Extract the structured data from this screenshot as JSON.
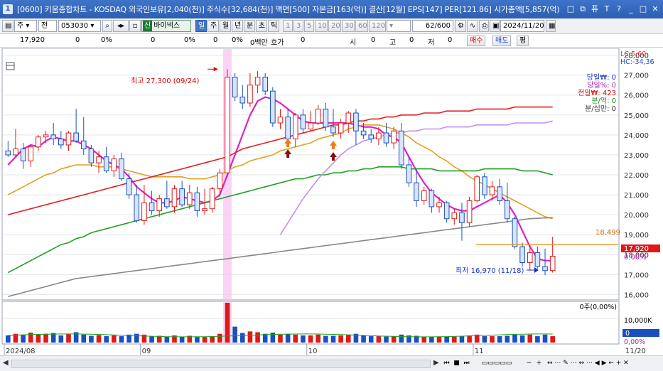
{
  "window": {
    "title": "[0600] 키움종합차트 - KOSDAQ 외국인보유[2,040(천)] 주식수[32,684(천)] 액면[500] 자본금[163(억)] 결산[12월] EPS[147] PER[121.86] 시가총액[5,857(억)",
    "title_icon": "1",
    "controls": [
      "□",
      "⧉",
      "퓨",
      "T",
      "?",
      "_",
      "□",
      "✕"
    ]
  },
  "toolbar": {
    "period_type": "주",
    "compare": "전",
    "code": "053030",
    "sin": "신",
    "name": "바이넥스",
    "period_buttons": [
      "일",
      "주",
      "월",
      "년",
      "분",
      "초",
      "틱"
    ],
    "active_period": "일",
    "interval_buttons": [
      "1",
      "3",
      "5",
      "10",
      "20",
      "30",
      "60",
      "120"
    ],
    "count": "62",
    "count_total": "/600",
    "date": "2024/11/20"
  },
  "quote": {
    "price": "17,920",
    "v1": "0",
    "v1p": "0%",
    "v2": "0",
    "v2p": "0%",
    "v3": "0",
    "v3p": "0%",
    "unit": "0백만",
    "hoga_label": "호가",
    "hoga_val": "0",
    "si_label": "시",
    "si_val": "0",
    "go_label": "고",
    "go_val": "0",
    "jeo_label": "저",
    "jeo_val": "0",
    "buy": "매수",
    "sell": "매도",
    "pyeong": "평"
  },
  "chart_data": {
    "type": "candlestick",
    "y_axis": {
      "min": 15800,
      "max": 28200,
      "ticks": [
        "28,000",
        "27,000",
        "26,000",
        "25,000",
        "24,000",
        "23,000",
        "22,000",
        "21,000",
        "20,000",
        "19,000",
        "18,000",
        "17,000",
        "16,000"
      ]
    },
    "x_axis_labels": [
      "2024/08",
      "09",
      "10",
      "11",
      "11/20"
    ],
    "corner": {
      "lc": "LC:5,60",
      "hc": "HC:-34,36"
    },
    "info_labels": [
      {
        "text": "당일₩: 0",
        "color": "#1a2fc0"
      },
      {
        "text": "당일%: 0",
        "color": "#c018b8"
      },
      {
        "text": "전일₩: 423",
        "color": "#d60000"
      },
      {
        "text": "분/억: 0",
        "color": "#1d8a20"
      },
      {
        "text": "분/십만: 0",
        "color": "#333333"
      }
    ],
    "annotations": {
      "high": "최고 27,300 (09/24)",
      "low": "최저 16,970 (11/18)",
      "hline_value": "18,499",
      "current_price": "17,920",
      "current_pct": "0.00%"
    },
    "candles": [
      [
        23200,
        23700,
        22900,
        23000
      ],
      [
        23000,
        24300,
        22900,
        23300
      ],
      [
        23300,
        23600,
        22300,
        22700
      ],
      [
        22700,
        23500,
        22400,
        23400
      ],
      [
        23400,
        24000,
        23200,
        23900
      ],
      [
        23900,
        24200,
        23600,
        24000
      ],
      [
        24000,
        24600,
        23500,
        23800
      ],
      [
        23800,
        24200,
        23300,
        23500
      ],
      [
        23500,
        24200,
        23200,
        24100
      ],
      [
        24100,
        25300,
        23600,
        23700
      ],
      [
        23700,
        24900,
        23000,
        23300
      ],
      [
        23300,
        23500,
        22400,
        22600
      ],
      [
        22600,
        23200,
        22100,
        22900
      ],
      [
        22900,
        23400,
        22100,
        22200
      ],
      [
        22200,
        23000,
        21900,
        22800
      ],
      [
        22800,
        23100,
        21700,
        21800
      ],
      [
        21800,
        22100,
        20800,
        21000
      ],
      [
        21000,
        21500,
        19600,
        19700
      ],
      [
        19700,
        21500,
        19500,
        20600
      ],
      [
        20600,
        21200,
        20000,
        20200
      ],
      [
        20200,
        21000,
        19900,
        20800
      ],
      [
        20800,
        21700,
        20300,
        20400
      ],
      [
        20400,
        21500,
        20100,
        21300
      ],
      [
        21300,
        21700,
        20400,
        20500
      ],
      [
        20500,
        21500,
        20300,
        21100
      ],
      [
        21100,
        21400,
        19900,
        20200
      ],
      [
        20200,
        21300,
        20000,
        20300
      ],
      [
        20300,
        21400,
        20100,
        21300
      ],
      [
        21300,
        22300,
        20900,
        22100
      ],
      [
        22100,
        27300,
        21900,
        26900
      ],
      [
        26900,
        27100,
        25700,
        25900
      ],
      [
        25900,
        26500,
        25300,
        25600
      ],
      [
        25600,
        27100,
        25400,
        26500
      ],
      [
        26500,
        27200,
        26100,
        26900
      ],
      [
        26900,
        27100,
        26000,
        26200
      ],
      [
        26200,
        26400,
        24400,
        24600
      ],
      [
        24600,
        25300,
        24300,
        24900
      ],
      [
        24900,
        25300,
        23600,
        23800
      ],
      [
        23800,
        25100,
        23400,
        25000
      ],
      [
        25000,
        25300,
        24100,
        24300
      ],
      [
        24300,
        25200,
        24200,
        24600
      ],
      [
        24600,
        25500,
        24500,
        25300
      ],
      [
        25300,
        25600,
        24200,
        24400
      ],
      [
        24400,
        25300,
        23900,
        24100
      ],
      [
        24100,
        24800,
        23800,
        24600
      ],
      [
        24600,
        25200,
        24100,
        25100
      ],
      [
        25100,
        25300,
        23500,
        24200
      ],
      [
        24200,
        24600,
        23800,
        24000
      ],
      [
        24000,
        24300,
        23600,
        23800
      ],
      [
        23800,
        24400,
        23500,
        24100
      ],
      [
        24100,
        24600,
        23400,
        23600
      ],
      [
        23600,
        24400,
        23300,
        24200
      ],
      [
        24200,
        24600,
        22300,
        22500
      ],
      [
        22500,
        22900,
        21400,
        21600
      ],
      [
        21600,
        22300,
        20400,
        20700
      ],
      [
        20700,
        21400,
        20500,
        21200
      ],
      [
        21200,
        21300,
        20100,
        20400
      ],
      [
        20400,
        20900,
        20100,
        20600
      ],
      [
        20600,
        20700,
        19600,
        19800
      ],
      [
        19800,
        20300,
        19500,
        20100
      ],
      [
        20100,
        20600,
        18700,
        19600
      ],
      [
        19600,
        20900,
        19400,
        20700
      ],
      [
        20700,
        22000,
        20600,
        21900
      ],
      [
        21900,
        22100,
        20800,
        21000
      ],
      [
        21000,
        21700,
        20700,
        21400
      ],
      [
        21400,
        21800,
        20500,
        20700
      ],
      [
        20700,
        21600,
        19600,
        19800
      ],
      [
        19800,
        19900,
        18300,
        18400
      ],
      [
        18400,
        18600,
        17400,
        17600
      ],
      [
        17600,
        18500,
        17200,
        18100
      ],
      [
        18100,
        18400,
        17300,
        17400
      ],
      [
        17400,
        18300,
        16970,
        17200
      ],
      [
        17200,
        18900,
        17100,
        17920
      ]
    ],
    "moving_averages": [
      {
        "name": "MA5",
        "color": "#e020c8",
        "values": [
          22500,
          22900,
          23300,
          23500,
          23400,
          23700,
          23900,
          23800,
          23700,
          23700,
          23500,
          23300,
          23000,
          22700,
          22500,
          22300,
          21900,
          21400,
          21100,
          20800,
          20600,
          20600,
          20700,
          20900,
          20800,
          20700,
          20600,
          20700,
          21000,
          22000,
          23000,
          24000,
          25000,
          25700,
          25900,
          25800,
          25600,
          25300,
          25000,
          24700,
          24600,
          24600,
          24600,
          24600,
          24600,
          24600,
          24500,
          24400,
          24400,
          24300,
          24000,
          23900,
          23600,
          22900,
          22200,
          21600,
          21100,
          20800,
          20500,
          20300,
          20200,
          20200,
          20400,
          20600,
          20800,
          21000,
          20600,
          20000,
          19200,
          18400,
          17800,
          17700,
          17700
        ]
      },
      {
        "name": "MA20",
        "color": "#e0a020",
        "values": [
          21000,
          21200,
          21400,
          21600,
          21800,
          22000,
          22100,
          22300,
          22400,
          22500,
          22500,
          22500,
          22400,
          22400,
          22400,
          22300,
          22200,
          22100,
          22000,
          21900,
          21900,
          21900,
          21900,
          21900,
          21800,
          21800,
          21800,
          21900,
          22000,
          22200,
          22400,
          22500,
          22700,
          22800,
          22900,
          23000,
          23200,
          23300,
          23400,
          23500,
          23600,
          23800,
          23900,
          24000,
          24100,
          24300,
          24400,
          24500,
          24500,
          24500,
          24400,
          24300,
          24100,
          23900,
          23600,
          23400,
          23200,
          22900,
          22700,
          22400,
          22200,
          21900,
          21700,
          21500,
          21300,
          21100,
          20900,
          20700,
          20500,
          20300,
          20100,
          19900,
          19800
        ]
      },
      {
        "name": "MA60",
        "color": "#e02020",
        "values": [
          20000,
          20100,
          20200,
          20300,
          20400,
          20500,
          20600,
          20700,
          20800,
          20900,
          21000,
          21100,
          21200,
          21300,
          21400,
          21500,
          21600,
          21700,
          21800,
          21900,
          22000,
          22100,
          22200,
          22300,
          22400,
          22500,
          22600,
          22700,
          22800,
          22900,
          23100,
          23300,
          23400,
          23500,
          23600,
          23700,
          23800,
          23900,
          24000,
          24100,
          24200,
          24300,
          24400,
          24500,
          24500,
          24600,
          24700,
          24700,
          24800,
          24800,
          24900,
          24900,
          25000,
          25000,
          25000,
          25100,
          25100,
          25100,
          25200,
          25200,
          25200,
          25200,
          25300,
          25300,
          25300,
          25300,
          25300,
          25400,
          25400,
          25400,
          25400,
          25400,
          25400
        ]
      },
      {
        "name": "MA120",
        "color": "#20a020",
        "values": [
          17100,
          17300,
          17500,
          17700,
          17900,
          18100,
          18300,
          18500,
          18600,
          18800,
          18900,
          19100,
          19200,
          19300,
          19400,
          19500,
          19600,
          19700,
          19800,
          19900,
          20000,
          20100,
          20200,
          20300,
          20400,
          20500,
          20600,
          20700,
          20800,
          20900,
          21000,
          21100,
          21200,
          21300,
          21400,
          21500,
          21600,
          21700,
          21800,
          21800,
          21900,
          22000,
          22000,
          22100,
          22100,
          22200,
          22200,
          22300,
          22300,
          22400,
          22400,
          22400,
          22400,
          22300,
          22300,
          22300,
          22300,
          22200,
          22200,
          22200,
          22200,
          22200,
          22200,
          22300,
          22300,
          22300,
          22300,
          22300,
          22200,
          22200,
          22200,
          22100,
          22000
        ]
      },
      {
        "name": "MA240",
        "color": "#888888",
        "values": [
          15900,
          16000,
          16100,
          16200,
          16300,
          16400,
          16500,
          16600,
          16700,
          16800,
          16850,
          16900,
          16950,
          17000,
          17050,
          17100,
          17150,
          17200,
          17250,
          17300,
          17350,
          17400,
          17450,
          17500,
          17550,
          17600,
          17650,
          17700,
          17750,
          17800,
          17850,
          17900,
          17950,
          18000,
          18050,
          18100,
          18150,
          18200,
          18250,
          18300,
          18350,
          18400,
          18450,
          18500,
          18550,
          18600,
          18650,
          18700,
          18750,
          18800,
          18850,
          18900,
          18950,
          19000,
          19050,
          19100,
          19150,
          19200,
          19250,
          19300,
          19350,
          19400,
          19450,
          19500,
          19550,
          19600,
          19650,
          19700,
          19750,
          19800,
          19820,
          19840,
          19850
        ]
      },
      {
        "name": "MA_purple",
        "color": "#c090f0",
        "start_index": 36,
        "values": [
          19000,
          19600,
          20200,
          20800,
          21300,
          21800,
          22200,
          22600,
          23000,
          23300,
          23500,
          23700,
          23800,
          23900,
          24000,
          24100,
          24100,
          24200,
          24200,
          24300,
          24300,
          24300,
          24400,
          24400,
          24400,
          24400,
          24500,
          24500,
          24500,
          24500,
          24500,
          24600,
          24600,
          24600,
          24600,
          24600,
          24700
        ]
      }
    ],
    "volume": {
      "axis_labels": [
        "0주(0,00%)",
        "10,000K",
        "0",
        "0,00%"
      ],
      "values": [
        0.18,
        0.22,
        0.2,
        0.25,
        0.2,
        0.22,
        0.24,
        0.18,
        0.22,
        0.26,
        0.2,
        0.17,
        0.19,
        0.16,
        0.18,
        0.16,
        0.2,
        0.22,
        0.2,
        0.16,
        0.17,
        0.15,
        0.18,
        0.15,
        0.17,
        0.14,
        0.15,
        0.16,
        0.22,
        1.0,
        0.4,
        0.24,
        0.28,
        0.26,
        0.22,
        0.25,
        0.2,
        0.22,
        0.2,
        0.18,
        0.18,
        0.2,
        0.17,
        0.17,
        0.18,
        0.2,
        0.22,
        0.18,
        0.16,
        0.16,
        0.15,
        0.16,
        0.2,
        0.18,
        0.17,
        0.15,
        0.14,
        0.15,
        0.15,
        0.15,
        0.17,
        0.18,
        0.2,
        0.16,
        0.16,
        0.16,
        0.17,
        0.2,
        0.18,
        0.2,
        0.16,
        0.2,
        0.16
      ]
    }
  }
}
